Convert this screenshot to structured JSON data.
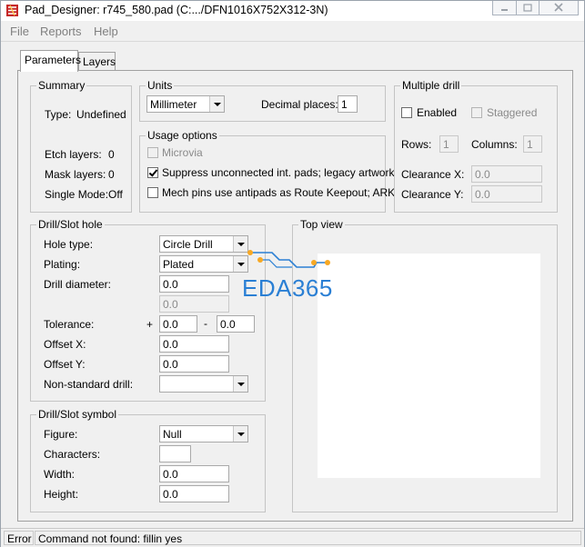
{
  "window": {
    "title": "Pad_Designer: r745_580.pad (C:.../DFN1016X752X312-3N)"
  },
  "menu": {
    "items": [
      "File",
      "Reports",
      "Help"
    ]
  },
  "tabs": {
    "parameters": "Parameters",
    "layers": "Layers"
  },
  "summary": {
    "title": "Summary",
    "type_label": "Type:",
    "type_value": "Undefined",
    "etch_label": "Etch layers:",
    "etch_value": "0",
    "mask_label": "Mask layers:",
    "mask_value": "0",
    "single_label": "Single Mode:",
    "single_value": "Off"
  },
  "units": {
    "title": "Units",
    "selected": "Millimeter",
    "decimal_label": "Decimal places:",
    "decimal_value": "1"
  },
  "usage": {
    "title": "Usage options",
    "microvia": "Microvia",
    "suppress": "Suppress unconnected int. pads; legacy artwork",
    "mech": "Mech pins use antipads as Route Keepout; ARK"
  },
  "multiple_drill": {
    "title": "Multiple drill",
    "enabled": "Enabled",
    "staggered": "Staggered",
    "rows_label": "Rows:",
    "rows_value": "1",
    "columns_label": "Columns:",
    "columns_value": "1",
    "clearance_x_label": "Clearance X:",
    "clearance_x_value": "0.0",
    "clearance_y_label": "Clearance Y:",
    "clearance_y_value": "0.0"
  },
  "drill_hole": {
    "title": "Drill/Slot hole",
    "hole_type_label": "Hole type:",
    "hole_type_value": "Circle Drill",
    "plating_label": "Plating:",
    "plating_value": "Plated",
    "diameter_label": "Drill diameter:",
    "diameter_value": "0.0",
    "diameter_value2": "0.0",
    "tolerance_label": "Tolerance:",
    "tol_plus": "+",
    "tol_plus_value": "0.0",
    "tol_minus": "-",
    "tol_minus_value": "0.0",
    "offset_x_label": "Offset X:",
    "offset_x_value": "0.0",
    "offset_y_label": "Offset Y:",
    "offset_y_value": "0.0",
    "nonstd_label": "Non-standard drill:",
    "nonstd_value": ""
  },
  "drill_symbol": {
    "title": "Drill/Slot symbol",
    "figure_label": "Figure:",
    "figure_value": "Null",
    "characters_label": "Characters:",
    "characters_value": "",
    "width_label": "Width:",
    "width_value": "0.0",
    "height_label": "Height:",
    "height_value": "0.0"
  },
  "top_view": {
    "title": "Top view"
  },
  "watermark": {
    "text": "EDA365"
  },
  "status": {
    "level": "Error",
    "message": "Command not found: fillin yes"
  }
}
